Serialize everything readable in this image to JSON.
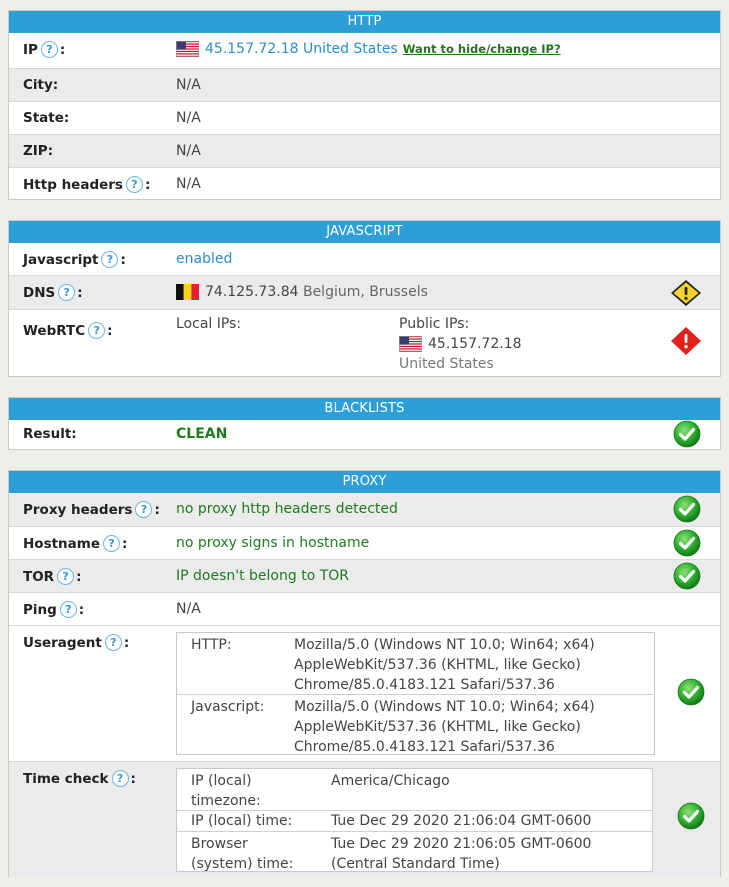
{
  "http": {
    "title": "HTTP",
    "ip_label": "IP",
    "ip_value": "45.157.72.18",
    "ip_country": "United States",
    "hide_link": "Want to hide/change IP?",
    "city_label": "City:",
    "city_value": "N/A",
    "state_label": "State:",
    "state_value": "N/A",
    "zip_label": "ZIP:",
    "zip_value": "N/A",
    "headers_label": "Http headers",
    "headers_value": "N/A"
  },
  "javascript": {
    "title": "JAVASCRIPT",
    "js_label": "Javascript",
    "js_value": "enabled",
    "dns_label": "DNS",
    "dns_ip": "74.125.73.84",
    "dns_location": "Belgium, Brussels",
    "webrtc_label": "WebRTC",
    "local_ips_label": "Local IPs:",
    "public_ips_label": "Public IPs:",
    "public_ip": "45.157.72.18",
    "public_country": "United States"
  },
  "blacklists": {
    "title": "BLACKLISTS",
    "result_label": "Result:",
    "result_value": "CLEAN"
  },
  "proxy": {
    "title": "PROXY",
    "headers_label": "Proxy headers",
    "headers_value": "no proxy http headers detected",
    "hostname_label": "Hostname",
    "hostname_value": "no proxy signs in hostname",
    "tor_label": "TOR",
    "tor_value": "IP doesn't belong to TOR",
    "ping_label": "Ping",
    "ping_value": "N/A",
    "useragent_label": "Useragent",
    "ua_http_key": "HTTP:",
    "ua_http_lines": [
      "Mozilla/5.0 (Windows NT 10.0; Win64; x64)",
      "AppleWebKit/537.36 (KHTML, like Gecko)",
      "Chrome/85.0.4183.121 Safari/537.36"
    ],
    "ua_js_key": "Javascript:",
    "ua_js_lines": [
      "Mozilla/5.0 (Windows NT 10.0; Win64; x64)",
      "AppleWebKit/537.36 (KHTML, like Gecko)",
      "Chrome/85.0.4183.121 Safari/537.36"
    ],
    "timecheck_label": "Time check",
    "tz_key_lines": [
      "IP (local)",
      "timezone:"
    ],
    "tz_value": "America/Chicago",
    "local_time_key": "IP (local) time:",
    "local_time_value": "Tue Dec 29 2020 21:06:04 GMT-0600",
    "browser_time_key_lines": [
      "Browser",
      "(system) time:"
    ],
    "browser_time_value_lines": [
      "Tue Dec 29 2020 21:06:05 GMT-0600",
      "(Central Standard Time)"
    ]
  },
  "help_glyph": "?",
  "colon": ":",
  "icons": {
    "ok": "green-check-icon",
    "warn": "yellow-warning-icon",
    "alert": "red-alert-icon",
    "help": "question-mark-icon"
  },
  "colors": {
    "header": "#2e9fd6",
    "ok_green": "#1e7b1e",
    "link_blue": "#2e8ec6"
  }
}
